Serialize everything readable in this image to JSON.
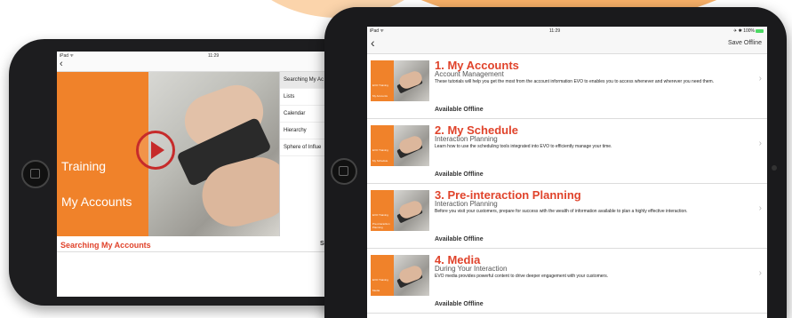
{
  "left": {
    "status": {
      "device": "iPad ᯤ",
      "time": "11:29"
    },
    "nav": {
      "back": "‹"
    },
    "media": {
      "line1": "Training",
      "line2": "My Accounts"
    },
    "menu": [
      "Searching My Ac",
      "Lists",
      "Calendar",
      "Hierarchy",
      "Sphere of Influe"
    ],
    "title": "Searching My Accounts",
    "save": "Sav"
  },
  "right": {
    "status": {
      "device": "iPad ᯤ",
      "time": "11:29",
      "battery": "✈ ✱ 100%"
    },
    "nav": {
      "back": "‹",
      "save": "Save Offline"
    },
    "rows": [
      {
        "title": "1. My Accounts",
        "subtitle": "Account Management",
        "desc": "These tutorials will help you get the most from the account information EVO to enables you to access whenever and wherever you need them.",
        "avail": "Available Offline",
        "thumb_top": "EVO Training",
        "thumb_bottom": "My Accounts"
      },
      {
        "title": "2. My Schedule",
        "subtitle": "Interaction Planning",
        "desc": "Learn how to use the scheduling tools integrated into EVO to efficiently manage your time.",
        "avail": "Available Offline",
        "thumb_top": "EVO Training",
        "thumb_bottom": "My Schedule"
      },
      {
        "title": "3. Pre-interaction Planning",
        "subtitle": "Interaction Planning",
        "desc": "Before you visit your customers, prepare for success with the wealth of information available to plan a highly effective interaction.",
        "avail": "Available Offline",
        "thumb_top": "EVO Training",
        "thumb_bottom": "Pre-interaction Planning"
      },
      {
        "title": "4. Media",
        "subtitle": "During Your Interaction",
        "desc": "EVO media provides powerful content to drive deeper engagement with your customers.",
        "avail": "Available Offline",
        "thumb_top": "EVO Training",
        "thumb_bottom": "Media"
      }
    ],
    "chevron": "›"
  }
}
